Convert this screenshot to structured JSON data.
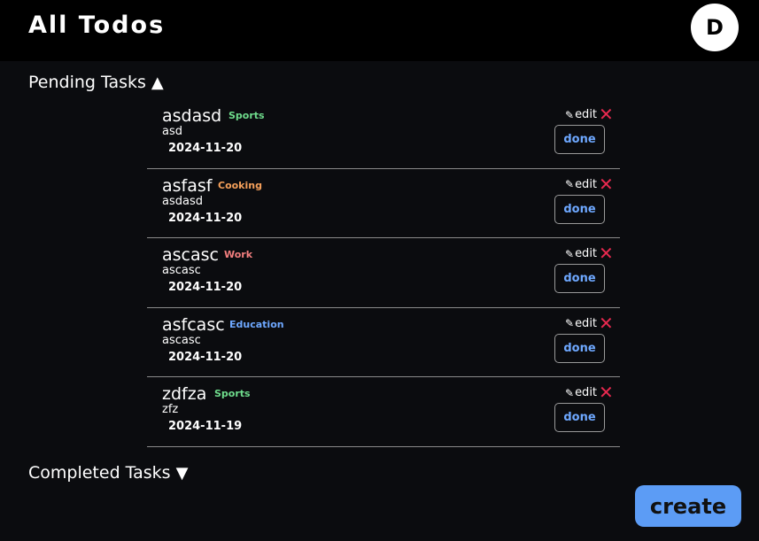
{
  "header": {
    "title": "All Todos",
    "avatar_initial": "D"
  },
  "sections": {
    "pending_label": "Pending Tasks",
    "pending_arrow": "▲",
    "completed_label": "Completed Tasks",
    "completed_arrow": "▼"
  },
  "todos": [
    {
      "title": "asdasd",
      "category": "Sports",
      "category_color": "#6fdc8c",
      "description": "asd",
      "date": "2024-11-20"
    },
    {
      "title": "asfasf",
      "category": "Cooking",
      "category_color": "#f5a05a",
      "description": "asdasd",
      "date": "2024-11-20"
    },
    {
      "title": "ascasc",
      "category": "Work",
      "category_color": "#f47f7f",
      "description": "ascasc",
      "date": "2024-11-20"
    },
    {
      "title": "asfcasc",
      "category": "Education",
      "category_color": "#6ea8ff",
      "description": "ascasc",
      "date": "2024-11-20"
    },
    {
      "title": "zdfza",
      "category": "Sports",
      "category_color": "#6fdc8c",
      "description": "zfz",
      "date": "2024-11-19"
    }
  ],
  "actions": {
    "edit_label": "edit",
    "pencil_icon": "✎",
    "delete_icon": "✕",
    "done_label": "done"
  },
  "create_label": "create"
}
